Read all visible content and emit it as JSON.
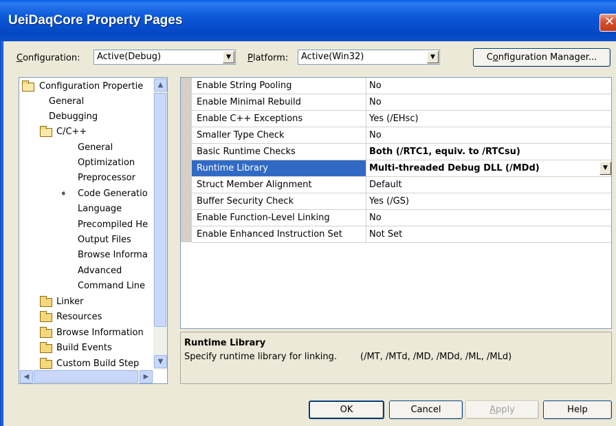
{
  "window": {
    "title": "UeiDaqCore Property Pages",
    "close_glyph": "✕"
  },
  "config": {
    "configuration_label_pre": "",
    "configuration_label_u": "C",
    "configuration_label_post": "onfiguration:",
    "configuration_value": "Active(Debug)",
    "platform_label_u": "P",
    "platform_label_post": "latform:",
    "platform_value": "Active(Win32)",
    "manager_button_pre": "C",
    "manager_button_u": "o",
    "manager_button_post": "nfiguration Manager..."
  },
  "tree": {
    "items": [
      {
        "label": "Configuration Propertie",
        "icon": "folder-open-icon"
      },
      {
        "label": "General"
      },
      {
        "label": "Debugging"
      },
      {
        "label": "C/C++",
        "icon": "folder-open-icon"
      },
      {
        "label": "General"
      },
      {
        "label": "Optimization"
      },
      {
        "label": "Preprocessor"
      },
      {
        "label": "Code Generatio",
        "icon": "selected-arrow-icon"
      },
      {
        "label": "Language"
      },
      {
        "label": "Precompiled He"
      },
      {
        "label": "Output Files"
      },
      {
        "label": "Browse Informa"
      },
      {
        "label": "Advanced"
      },
      {
        "label": "Command Line"
      },
      {
        "label": "Linker",
        "icon": "folder-icon"
      },
      {
        "label": "Resources",
        "icon": "folder-icon"
      },
      {
        "label": "Browse Information",
        "icon": "folder-icon"
      },
      {
        "label": "Build Events",
        "icon": "folder-icon"
      },
      {
        "label": "Custom Build Step",
        "icon": "folder-icon"
      }
    ]
  },
  "properties": {
    "rows": [
      {
        "name": "Enable String Pooling",
        "value": "No"
      },
      {
        "name": "Enable Minimal Rebuild",
        "value": "No"
      },
      {
        "name": "Enable C++ Exceptions",
        "value": "Yes (/EHsc)"
      },
      {
        "name": "Smaller Type Check",
        "value": "No"
      },
      {
        "name": "Basic Runtime Checks",
        "value": "Both (/RTC1, equiv. to /RTCsu)"
      },
      {
        "name": "Runtime Library",
        "value": "Multi-threaded Debug DLL (/MDd)"
      },
      {
        "name": "Struct Member Alignment",
        "value": "Default"
      },
      {
        "name": "Buffer Security Check",
        "value": "Yes (/GS)"
      },
      {
        "name": "Enable Function-Level Linking",
        "value": "No"
      },
      {
        "name": "Enable Enhanced Instruction Set",
        "value": "Not Set"
      }
    ],
    "selected_index": 5
  },
  "description": {
    "title": "Runtime Library",
    "text": "Specify runtime library for linking.",
    "options": "(/MT, /MTd, /MD, /MDd, /ML, /MLd)"
  },
  "buttons": {
    "ok": "OK",
    "cancel": "Cancel",
    "apply_u": "A",
    "apply_post": "pply",
    "help": "Help"
  },
  "colors": {
    "titlebar": "#0a58d8",
    "selection": "#316ac5",
    "dialog_bg": "#ece9d8"
  }
}
